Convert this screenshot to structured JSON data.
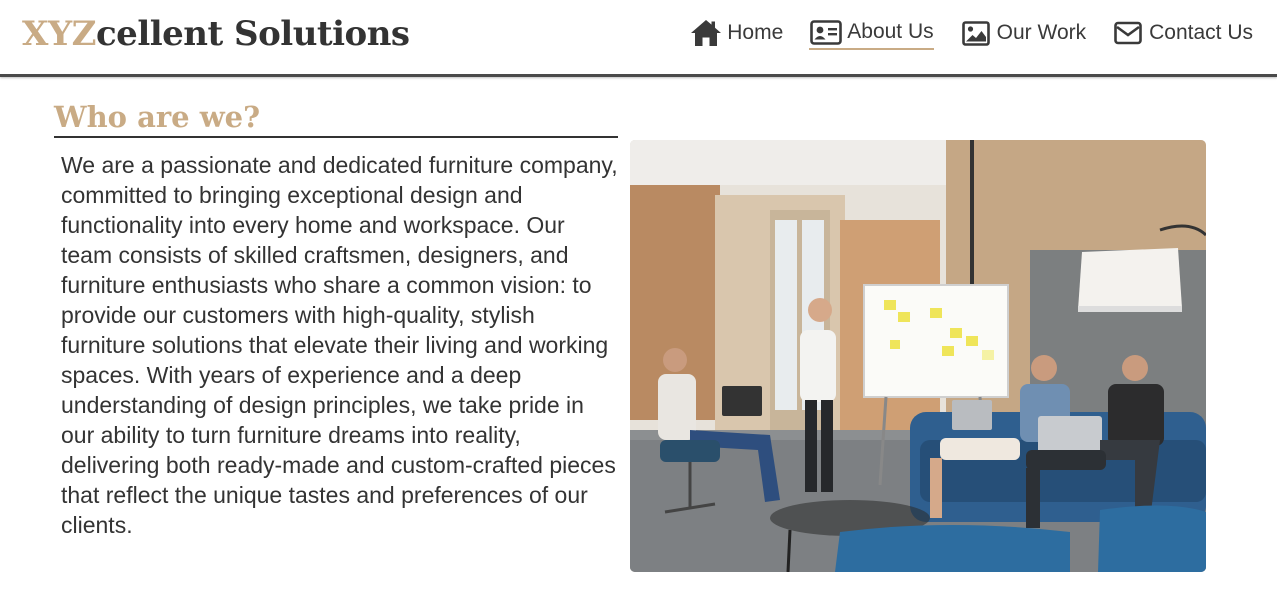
{
  "logo": {
    "accent": "XYZ",
    "rest": "cellent Solutions"
  },
  "nav": [
    {
      "label": "Home",
      "icon": "house-icon",
      "active": false
    },
    {
      "label": "About Us",
      "icon": "id-card-icon",
      "active": true
    },
    {
      "label": "Our Work",
      "icon": "image-icon",
      "active": false
    },
    {
      "label": "Contact Us",
      "icon": "envelope-icon",
      "active": false
    }
  ],
  "about": {
    "heading": "Who are we?",
    "body": "We are a passionate and dedicated furniture company, committed to bringing exceptional design and functionality into every home and workspace. Our team consists of skilled craftsmen, designers, and furniture enthusiasts who share a common vision: to provide our customers with high-quality, stylish furniture solutions that elevate their living and working spaces. With years of experience and a deep understanding of design principles, we take pride in our ability to turn furniture dreams into reality, delivering both ready-made and custom-crafted pieces that reflect the unique tastes and preferences of our clients."
  },
  "colors": {
    "accent": "#c9ab85",
    "text": "#333333",
    "rule": "#4a4a4a"
  }
}
